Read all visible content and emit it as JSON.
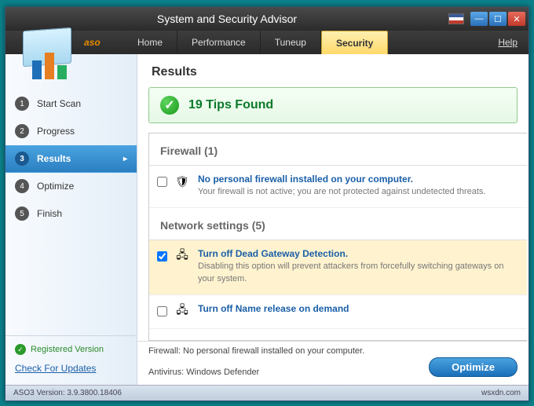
{
  "title": "System and Security Advisor",
  "brand": "aso",
  "menu": {
    "tabs": [
      "Home",
      "Performance",
      "Tuneup",
      "Security"
    ],
    "active": 3,
    "help": "Help"
  },
  "steps": [
    {
      "num": "1",
      "label": "Start Scan"
    },
    {
      "num": "2",
      "label": "Progress"
    },
    {
      "num": "3",
      "label": "Results"
    },
    {
      "num": "4",
      "label": "Optimize"
    },
    {
      "num": "5",
      "label": "Finish"
    }
  ],
  "steps_active": 2,
  "sidebar_footer": {
    "registered": "Registered Version",
    "check_updates": "Check For Updates"
  },
  "results": {
    "heading": "Results",
    "tips_found": "19 Tips Found",
    "sections": [
      {
        "name": "Firewall",
        "count": "(1)",
        "items": [
          {
            "checked": false,
            "icon": "shield",
            "title": "No personal firewall installed on your computer.",
            "desc": "Your firewall is not active; you are not protected against undetected threats."
          }
        ]
      },
      {
        "name": "Network settings",
        "count": "(5)",
        "items": [
          {
            "checked": true,
            "icon": "net",
            "hl": true,
            "title": "Turn off Dead Gateway Detection.",
            "desc": "Disabling this option will prevent attackers from forcefully switching gateways on your system."
          },
          {
            "checked": false,
            "icon": "net",
            "title": "Turn off Name release on demand",
            "desc": ""
          }
        ]
      }
    ]
  },
  "footer": {
    "firewall_line": "Firewall: No personal firewall installed on your computer.",
    "antivirus_line": "Antivirus: Windows Defender",
    "optimize_label": "Optimize"
  },
  "status": {
    "version": "ASO3 Version: 3.9.3800.18406",
    "right": "wsxdn.com"
  }
}
